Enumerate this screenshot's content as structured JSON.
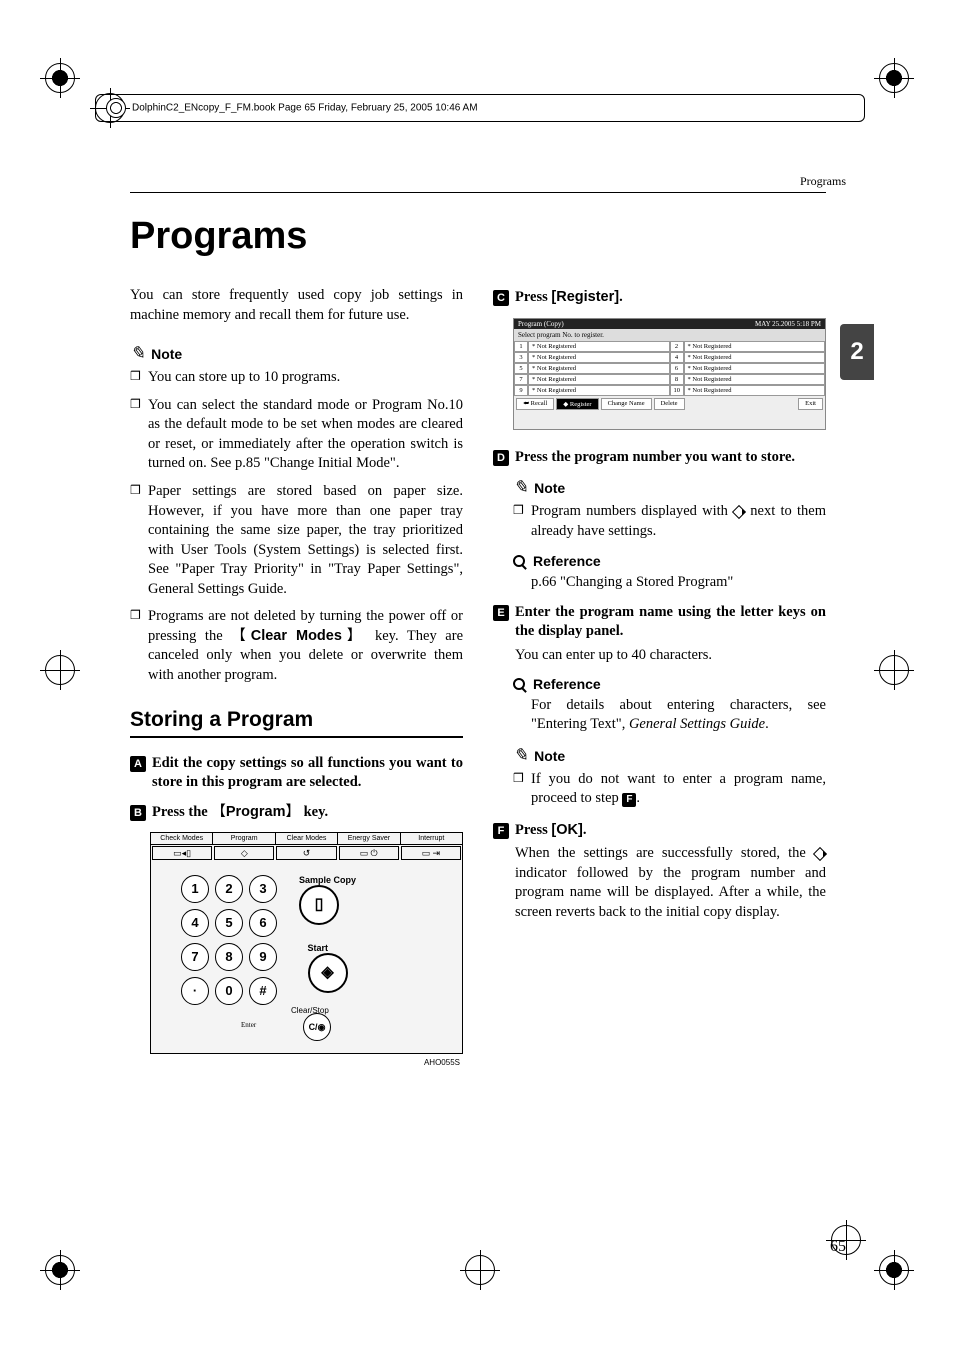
{
  "header_line": "DolphinC2_ENcopy_F_FM.book  Page 65  Friday, February 25, 2005  10:46 AM",
  "running_head": "Programs",
  "title": "Programs",
  "intro": "You can store frequently used copy job settings in machine memory and recall them for future use.",
  "note_label": "Note",
  "reference_label": "Reference",
  "notes1": [
    "You can store up to 10 programs.",
    "You can select the standard mode or Program No.10 as the default mode to be set when modes are cleared or reset, or immediately after the operation switch is turned on. See p.85 \"Change Initial Mode\".",
    "Paper settings are stored based on paper size. However, if you have more than one paper tray containing the same size paper, the tray prioritized with User Tools (System Settings) is selected first. See \"Paper Tray Priority\" in \"Tray Paper Settings\", General Settings Guide.",
    "Programs are not deleted by turning the power off or pressing the {Clear Modes} key. They are canceled only when you delete or overwrite them with another program."
  ],
  "h2": "Storing a Program",
  "steps": {
    "s1": "Edit the copy settings so all functions you want to store in this program are selected.",
    "s2_a": "Press the ",
    "s2_key": "Program",
    "s2_b": " key.",
    "s3_a": "Press ",
    "s3_btn": "[Register]",
    "s3_b": ".",
    "s4": "Press the program number you want to store.",
    "s5": "Enter the program name using the letter keys on the display panel.",
    "s5_after": "You can enter up to 40 characters.",
    "s6_a": "Press ",
    "s6_btn": "[OK]",
    "s6_b": ".",
    "s6_after": "When the settings are successfully stored, the  indicator followed by the program number and program name will be displayed. After a while, the screen reverts back to the initial copy display."
  },
  "note4": "Program numbers displayed with  next to them already have settings.",
  "ref4": "p.66 \"Changing a Stored Program\"",
  "ref5": "For details about entering characters, see \"Entering Text\", General Settings Guide.",
  "note5": "If you do not want to enter a program name, proceed to step F.",
  "fig1": {
    "toprow": [
      "Check Modes",
      "Program",
      "Clear Modes",
      "Energy Saver",
      "Interrupt"
    ],
    "nums": [
      "1",
      "2",
      "3",
      "4",
      "5",
      "6",
      "7",
      "8",
      "9",
      "·",
      "0",
      "#"
    ],
    "sample": "Sample Copy",
    "start": "Start",
    "clearstop": "Clear/Stop",
    "enter": "Enter",
    "cap": "AHO055S"
  },
  "fig2": {
    "title": "Program (Copy)",
    "time": "MAY   25.2005   5:18 PM",
    "sub": "Select program No. to register.",
    "rows": [
      [
        "1",
        "* Not Registered",
        "2",
        "* Not Registered"
      ],
      [
        "3",
        "* Not Registered",
        "4",
        "* Not Registered"
      ],
      [
        "5",
        "* Not Registered",
        "6",
        "* Not Registered"
      ],
      [
        "7",
        "* Not Registered",
        "8",
        "* Not Registered"
      ],
      [
        "9",
        "* Not Registered",
        "10",
        "* Not Registered"
      ]
    ],
    "btns": [
      "⮨ Recall",
      "◆ Register",
      "Change Name",
      "Delete",
      "Exit"
    ]
  },
  "tab": "2",
  "pagenum": "65"
}
